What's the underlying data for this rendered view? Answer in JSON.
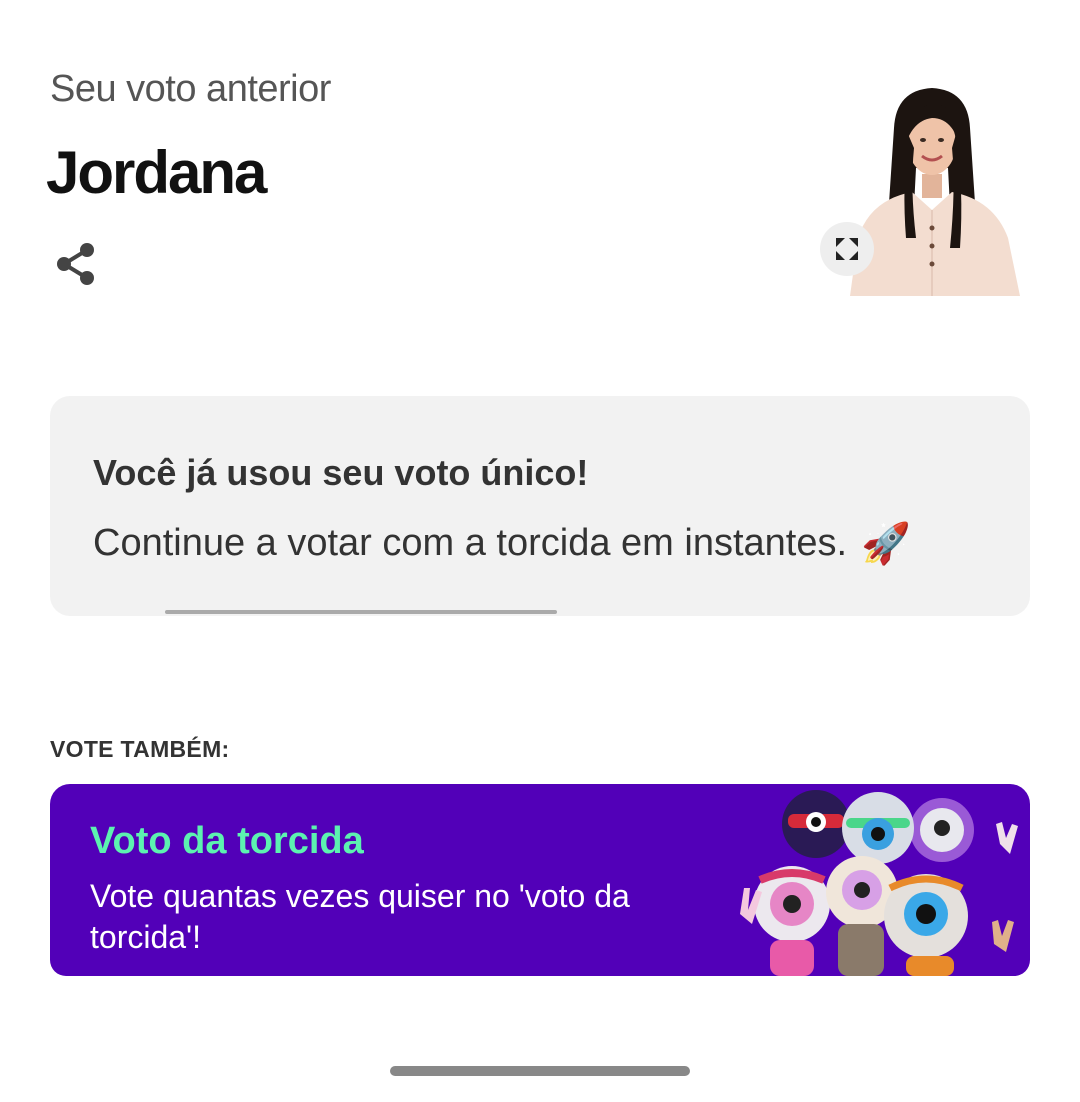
{
  "previous_vote": {
    "label": "Seu voto anterior",
    "candidate_name": "Jordana",
    "share_icon": "share-icon",
    "expand_icon": "expand-icon"
  },
  "notice": {
    "title": "Você já usou seu voto único!",
    "message": "Continue a votar com a torcida em instantes.",
    "emoji": "🚀"
  },
  "vote_also": {
    "heading": "VOTE TAMBÉM:",
    "card": {
      "title": "Voto da torcida",
      "description": "Vote quantas vezes quiser no 'voto da torcida'!",
      "title_color": "#5cf2b0",
      "background_color": "#5200b8"
    }
  }
}
